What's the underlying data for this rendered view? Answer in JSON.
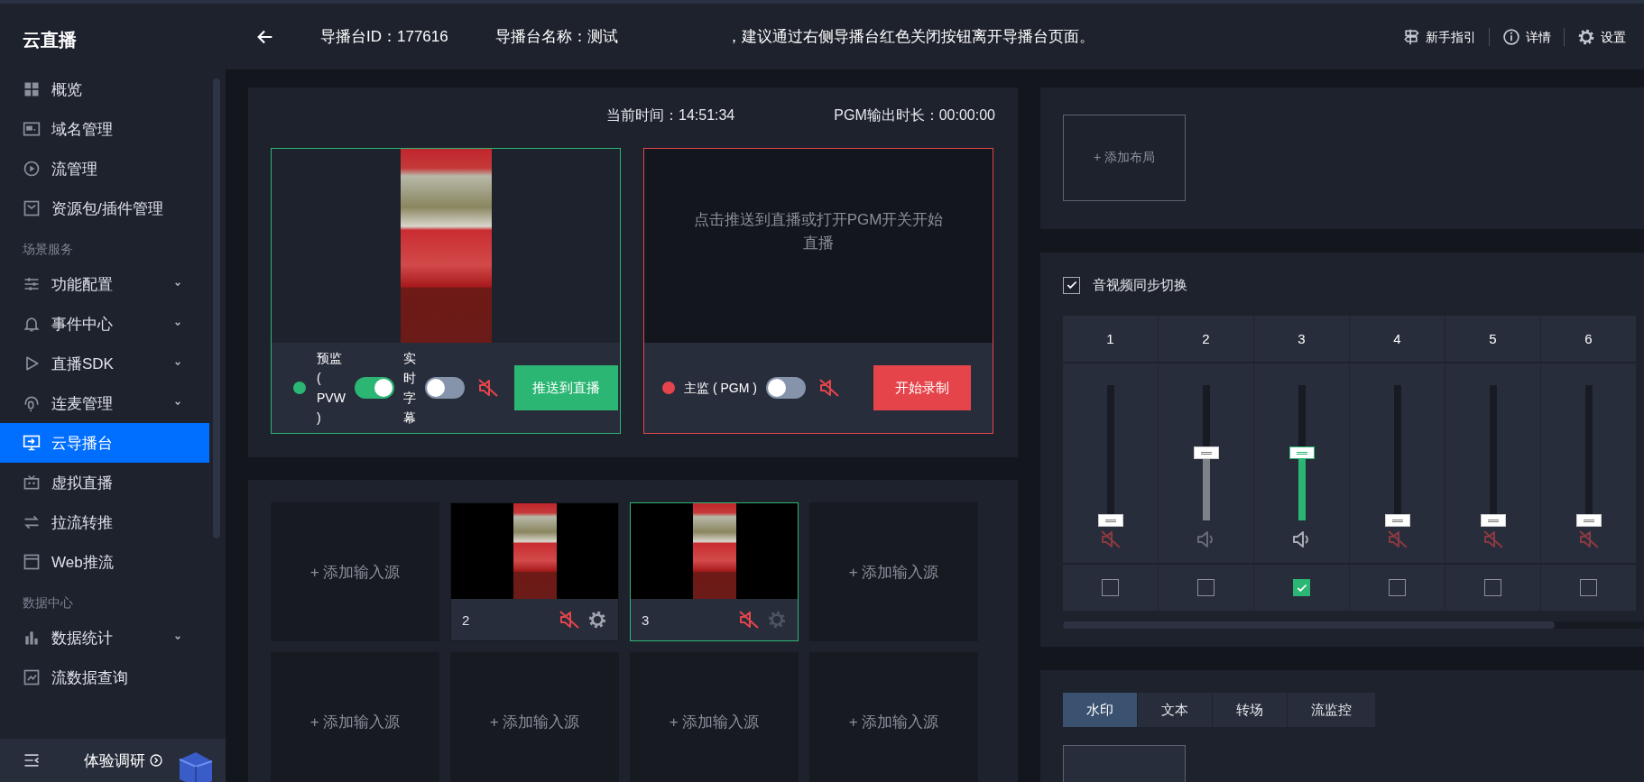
{
  "sidebar": {
    "title": "云直播",
    "sections": [
      {
        "items": [
          {
            "label": "概览",
            "has_submenu": false,
            "selected": false
          },
          {
            "label": "域名管理",
            "has_submenu": false,
            "selected": false
          },
          {
            "label": "流管理",
            "has_submenu": false,
            "selected": false
          },
          {
            "label": "资源包/插件管理",
            "has_submenu": false,
            "selected": false
          }
        ]
      },
      {
        "heading": "场景服务",
        "items": [
          {
            "label": "功能配置",
            "has_submenu": true,
            "selected": false
          },
          {
            "label": "事件中心",
            "has_submenu": true,
            "selected": false
          },
          {
            "label": "直播SDK",
            "has_submenu": true,
            "selected": false
          },
          {
            "label": "连麦管理",
            "has_submenu": true,
            "selected": false
          },
          {
            "label": "云导播台",
            "has_submenu": false,
            "selected": true
          },
          {
            "label": "虚拟直播",
            "has_submenu": false,
            "selected": false
          },
          {
            "label": "拉流转推",
            "has_submenu": false,
            "selected": false
          },
          {
            "label": "Web推流",
            "has_submenu": false,
            "selected": false
          }
        ]
      },
      {
        "heading": "数据中心",
        "items": [
          {
            "label": "数据统计",
            "has_submenu": true,
            "selected": false
          },
          {
            "label": "流数据查询",
            "has_submenu": false,
            "selected": false
          }
        ]
      }
    ],
    "footer": {
      "label": "体验调研"
    }
  },
  "header": {
    "console_id": "导播台ID：177616",
    "console_name": "导播台名称：测试",
    "notice": "，建议通过右侧导播台红色关闭按钮离开导播台页面。",
    "links": [
      {
        "label": "新手指引"
      },
      {
        "label": "详情"
      },
      {
        "label": "设置"
      }
    ]
  },
  "monitor": {
    "current_time": "当前时间：14:51:34",
    "pgm_duration": "PGM输出时长：00:00:00",
    "preview": {
      "label": "预监 ( PVW )",
      "on": true,
      "subtitle_label": "实时字幕",
      "subtitle_on": false,
      "muted": true,
      "button": "推送到直播"
    },
    "program": {
      "placeholder": "点击推送到直播或打开PGM开关开始直播",
      "label": "主监 ( PGM )",
      "on": false,
      "muted": true,
      "button": "开始录制"
    }
  },
  "sources": [
    {
      "kind": "add",
      "label": "+ 添加输入源",
      "selected": false
    },
    {
      "kind": "source",
      "number": "2",
      "muted": true,
      "selected": false
    },
    {
      "kind": "source",
      "number": "3",
      "muted": true,
      "selected": true
    },
    {
      "kind": "add",
      "label": "+ 添加输入源",
      "selected": false
    },
    {
      "kind": "add",
      "label": "+ 添加输入源",
      "selected": false
    },
    {
      "kind": "add",
      "label": "+ 添加输入源",
      "selected": false
    },
    {
      "kind": "add",
      "label": "+ 添加输入源",
      "selected": false
    },
    {
      "kind": "add",
      "label": "+ 添加输入源",
      "selected": false
    }
  ],
  "layouts": {
    "add_label": "+ 添加布局"
  },
  "mixer": {
    "sync": {
      "label": "音视频同步切换",
      "checked": true
    },
    "channels": [
      {
        "label": "1",
        "level": 0,
        "muted": true,
        "checked": false
      },
      {
        "label": "2",
        "level": 0.5,
        "muted": false,
        "checked": false
      },
      {
        "label": "3",
        "level": 0.5,
        "muted": false,
        "checked": true
      },
      {
        "label": "4",
        "level": 0,
        "muted": true,
        "checked": false
      },
      {
        "label": "5",
        "level": 0,
        "muted": true,
        "checked": false
      },
      {
        "label": "6",
        "level": 0,
        "muted": true,
        "checked": false
      }
    ]
  },
  "tabs": [
    {
      "label": "水印",
      "selected": true
    },
    {
      "label": "文本",
      "selected": false
    },
    {
      "label": "转场",
      "selected": false
    },
    {
      "label": "流监控",
      "selected": false
    }
  ]
}
